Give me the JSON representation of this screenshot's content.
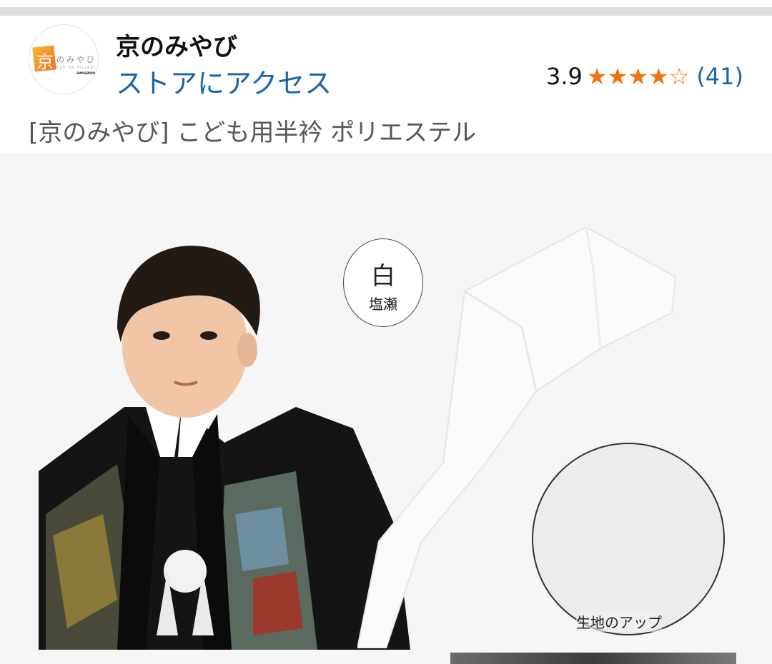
{
  "store": {
    "logo": {
      "mark": "京",
      "kana": "のみやび",
      "romaji": "kyo no miyabi",
      "brand": "amazon"
    },
    "name": "京のみやび",
    "link_label": "ストアにアクセス",
    "rating_value": "3.9",
    "rating_stars": 3.9,
    "rating_count": "(41)"
  },
  "product": {
    "title": "[京のみやび] こども用半衿 ポリエステル",
    "image": {
      "badge_color": "白",
      "badge_type": "塩瀬",
      "closeup_label": "生地のアップ"
    }
  },
  "colors": {
    "link": "#1a65a8",
    "star": "#f0730f",
    "divider": "#dcdfe2"
  }
}
